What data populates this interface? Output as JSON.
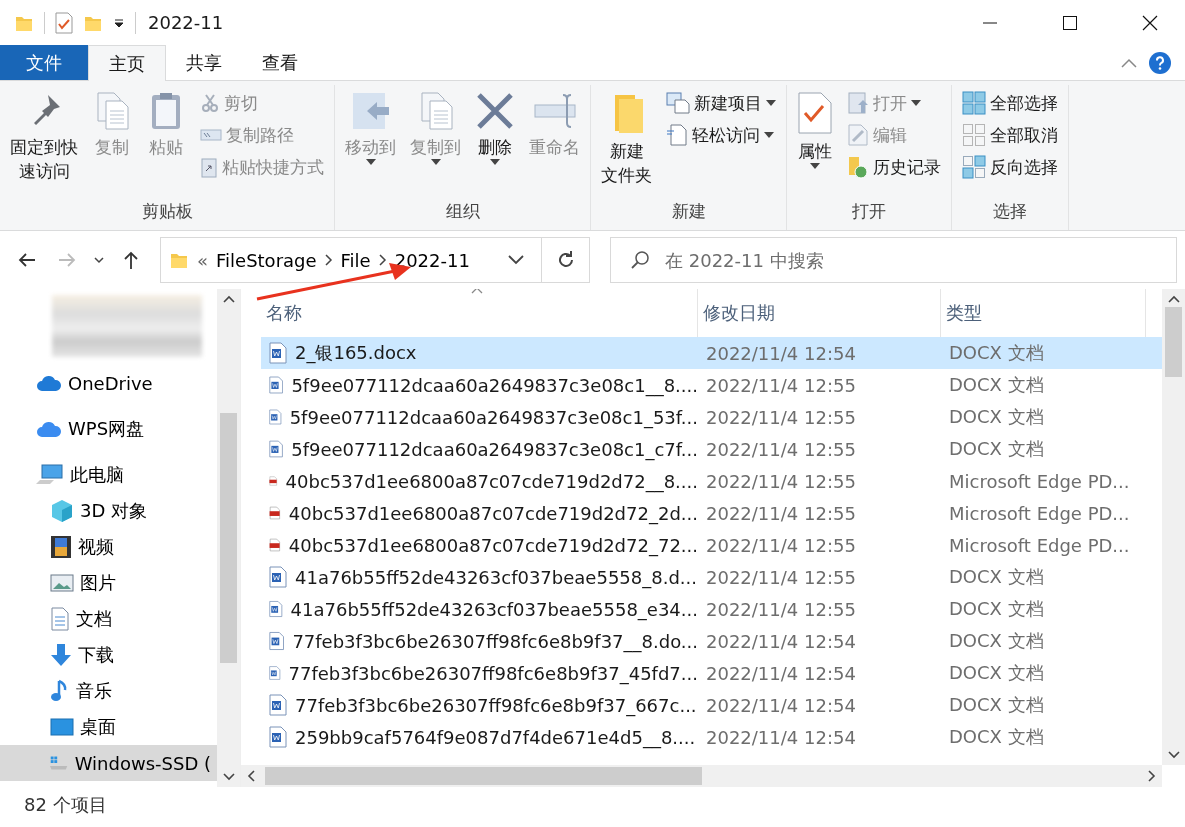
{
  "window": {
    "title": "2022-11"
  },
  "ribbon_tabs": [
    {
      "label": "文件",
      "kind": "file",
      "selected": false
    },
    {
      "label": "主页",
      "kind": "tab",
      "selected": true
    },
    {
      "label": "共享",
      "kind": "tab",
      "selected": false
    },
    {
      "label": "查看",
      "kind": "tab",
      "selected": false
    }
  ],
  "ribbon_groups": [
    {
      "label": "剪贴板",
      "items": [
        {
          "kind": "large",
          "lines": [
            "固定到快",
            "速访问"
          ],
          "disabled": false,
          "dropdown": false
        },
        {
          "kind": "large",
          "lines": [
            "复制"
          ],
          "disabled": true,
          "dropdown": false
        },
        {
          "kind": "large",
          "lines": [
            "粘贴"
          ],
          "disabled": true,
          "dropdown": false
        },
        {
          "kind": "stack",
          "items": [
            {
              "label": "剪切",
              "disabled": true,
              "dropdown": false
            },
            {
              "label": "复制路径",
              "disabled": true,
              "dropdown": false
            },
            {
              "label": "粘贴快捷方式",
              "disabled": true,
              "dropdown": false
            }
          ]
        }
      ]
    },
    {
      "label": "组织",
      "items": [
        {
          "kind": "large",
          "lines": [
            "移动到"
          ],
          "disabled": true,
          "dropdown": true
        },
        {
          "kind": "large",
          "lines": [
            "复制到"
          ],
          "disabled": true,
          "dropdown": true
        },
        {
          "kind": "large",
          "lines": [
            "删除"
          ],
          "disabled": false,
          "dropdown": true
        },
        {
          "kind": "large",
          "lines": [
            "重命名"
          ],
          "disabled": true,
          "dropdown": false
        }
      ]
    },
    {
      "label": "新建",
      "items": [
        {
          "kind": "large",
          "lines": [
            "新建",
            "文件夹"
          ],
          "disabled": false,
          "dropdown": false
        },
        {
          "kind": "stack",
          "items": [
            {
              "label": "新建项目",
              "disabled": false,
              "dropdown": true
            },
            {
              "label": "轻松访问",
              "disabled": false,
              "dropdown": true
            }
          ]
        }
      ]
    },
    {
      "label": "打开",
      "items": [
        {
          "kind": "large",
          "lines": [
            "属性"
          ],
          "disabled": false,
          "dropdown": true
        },
        {
          "kind": "stack",
          "items": [
            {
              "label": "打开",
              "disabled": true,
              "dropdown": true
            },
            {
              "label": "编辑",
              "disabled": true,
              "dropdown": false
            },
            {
              "label": "历史记录",
              "disabled": false,
              "dropdown": false
            }
          ]
        }
      ]
    },
    {
      "label": "选择",
      "items": [
        {
          "kind": "stack",
          "items": [
            {
              "label": "全部选择",
              "disabled": false,
              "dropdown": false
            },
            {
              "label": "全部取消",
              "disabled": false,
              "dropdown": false
            },
            {
              "label": "反向选择",
              "disabled": false,
              "dropdown": false
            }
          ]
        }
      ]
    }
  ],
  "address_bar": {
    "overflow": "«",
    "path": [
      "FileStorage",
      "File",
      "2022-11"
    ]
  },
  "search": {
    "placeholder": "在 2022-11 中搜索"
  },
  "navigation": [
    {
      "kind": "blurred"
    },
    {
      "kind": "cloud",
      "label": "OneDrive",
      "selected": false
    },
    {
      "kind": "wps",
      "label": "WPS网盘",
      "selected": false
    },
    {
      "kind": "pc",
      "label": "此电脑",
      "selected": false,
      "children": [
        {
          "kind": "cube",
          "label": "3D 对象",
          "selected": false
        },
        {
          "kind": "video",
          "label": "视频",
          "selected": false
        },
        {
          "kind": "picture",
          "label": "图片",
          "selected": false
        },
        {
          "kind": "document",
          "label": "文档",
          "selected": false
        },
        {
          "kind": "download",
          "label": "下载",
          "selected": false
        },
        {
          "kind": "music",
          "label": "音乐",
          "selected": false
        },
        {
          "kind": "desktop",
          "label": "桌面",
          "selected": false
        },
        {
          "kind": "drive",
          "label": "Windows-SSD (",
          "selected": true
        }
      ]
    }
  ],
  "file_list": {
    "columns": [
      "名称",
      "修改日期",
      "类型"
    ],
    "rows": [
      {
        "kind": "docx",
        "name": "2_银165.docx",
        "modified": "2022/11/4 12:54",
        "type": "DOCX 文档",
        "selected": true
      },
      {
        "kind": "docx",
        "name": "5f9ee077112dcaa60a2649837c3e08c1__8....",
        "modified": "2022/11/4 12:55",
        "type": "DOCX 文档",
        "selected": false
      },
      {
        "kind": "docx",
        "name": "5f9ee077112dcaa60a2649837c3e08c1_53f...",
        "modified": "2022/11/4 12:55",
        "type": "DOCX 文档",
        "selected": false
      },
      {
        "kind": "docx",
        "name": "5f9ee077112dcaa60a2649837c3e08c1_c7f...",
        "modified": "2022/11/4 12:55",
        "type": "DOCX 文档",
        "selected": false
      },
      {
        "kind": "pdf",
        "name": "40bc537d1ee6800a87c07cde719d2d72__8....",
        "modified": "2022/11/4 12:55",
        "type": "Microsoft Edge PD...",
        "selected": false
      },
      {
        "kind": "pdf",
        "name": "40bc537d1ee6800a87c07cde719d2d72_2d...",
        "modified": "2022/11/4 12:55",
        "type": "Microsoft Edge PD...",
        "selected": false
      },
      {
        "kind": "pdf",
        "name": "40bc537d1ee6800a87c07cde719d2d72_72...",
        "modified": "2022/11/4 12:55",
        "type": "Microsoft Edge PD...",
        "selected": false
      },
      {
        "kind": "docx",
        "name": "41a76b55ff52de43263cf037beae5558_8.d...",
        "modified": "2022/11/4 12:55",
        "type": "DOCX 文档",
        "selected": false
      },
      {
        "kind": "docx",
        "name": "41a76b55ff52de43263cf037beae5558_e34...",
        "modified": "2022/11/4 12:55",
        "type": "DOCX 文档",
        "selected": false
      },
      {
        "kind": "docx",
        "name": "77feb3f3bc6be26307ff98fc6e8b9f37__8.do...",
        "modified": "2022/11/4 12:54",
        "type": "DOCX 文档",
        "selected": false
      },
      {
        "kind": "docx",
        "name": "77feb3f3bc6be26307ff98fc6e8b9f37_45fd7...",
        "modified": "2022/11/4 12:54",
        "type": "DOCX 文档",
        "selected": false
      },
      {
        "kind": "docx",
        "name": "77feb3f3bc6be26307ff98fc6e8b9f37_667c...",
        "modified": "2022/11/4 12:54",
        "type": "DOCX 文档",
        "selected": false
      },
      {
        "kind": "docx",
        "name": "259bb9caf5764f9e087d7f4de671e4d5__8....",
        "modified": "2022/11/4 12:54",
        "type": "DOCX 文档",
        "selected": false
      }
    ]
  },
  "status_bar": {
    "item_count": "82 个项目"
  }
}
